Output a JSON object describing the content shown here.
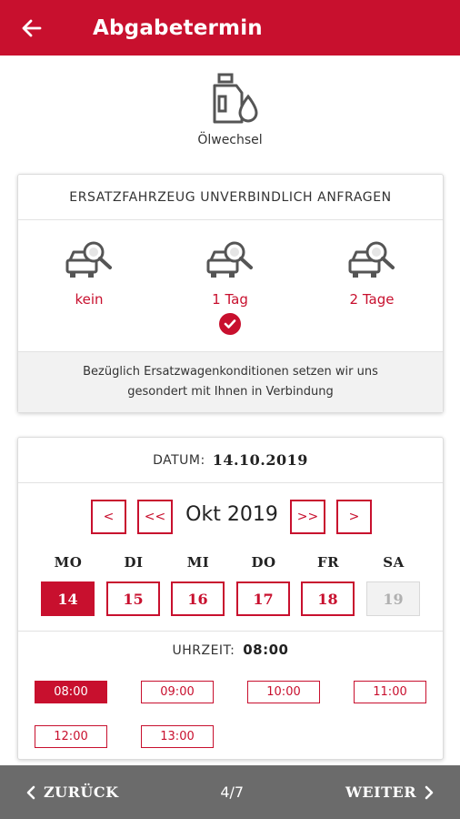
{
  "header": {
    "title": "Abgabetermin",
    "back_icon": "arrow-left-icon"
  },
  "service": {
    "label": "Ölwechsel",
    "icon": "oil-canister-icon"
  },
  "replacement": {
    "heading": "ERSATZFAHRZEUG UNVERBINDLICH ANFRAGEN",
    "options": [
      {
        "label": "kein",
        "icon": "car-search-icon",
        "selected": false
      },
      {
        "label": "1 Tag",
        "icon": "car-search-icon",
        "selected": true
      },
      {
        "label": "2 Tage",
        "icon": "car-search-icon",
        "selected": false
      }
    ],
    "note_line1": "Bezüglich Ersatzwagenkonditionen setzen wir uns",
    "note_line2": "gesondert mit Ihnen in Verbindung"
  },
  "calendar": {
    "date_label": "DATUM:",
    "date_value": "14.10.2019",
    "prev_label": "<",
    "prev_prev_label": "<<",
    "month_label": "Okt 2019",
    "next_next_label": ">>",
    "next_label": ">",
    "weekdays": [
      "MO",
      "DI",
      "MI",
      "DO",
      "FR",
      "SA"
    ],
    "days": [
      {
        "label": "14",
        "state": "selected"
      },
      {
        "label": "15",
        "state": "available"
      },
      {
        "label": "16",
        "state": "available"
      },
      {
        "label": "17",
        "state": "available"
      },
      {
        "label": "18",
        "state": "available"
      },
      {
        "label": "19",
        "state": "disabled"
      }
    ]
  },
  "time": {
    "label": "UHRZEIT:",
    "value": "08:00",
    "slots": [
      {
        "label": "08:00",
        "selected": true
      },
      {
        "label": "09:00",
        "selected": false
      },
      {
        "label": "10:00",
        "selected": false
      },
      {
        "label": "11:00",
        "selected": false
      },
      {
        "label": "12:00",
        "selected": false
      },
      {
        "label": "13:00",
        "selected": false
      }
    ]
  },
  "footer": {
    "back_label": "ZURÜCK",
    "page": "4/7",
    "next_label": "WEITER"
  },
  "colors": {
    "accent": "#c8102e",
    "footer": "#6b6b6b"
  }
}
